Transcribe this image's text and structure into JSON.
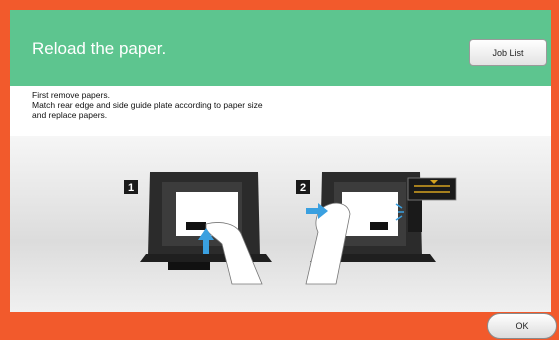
{
  "dialog": {
    "title": "Reload the paper.",
    "job_list_label": "Job List",
    "ok_label": "OK"
  },
  "instructions": {
    "lines": [
      "First remove papers.",
      "Match rear edge and side guide plate according to paper size",
      "and replace papers."
    ]
  },
  "illustration": {
    "step1_label": "1",
    "step2_label": "2"
  },
  "colors": {
    "frame": "#f25a2c",
    "header": "#5dc58f",
    "arrow": "#3aa0e0"
  }
}
